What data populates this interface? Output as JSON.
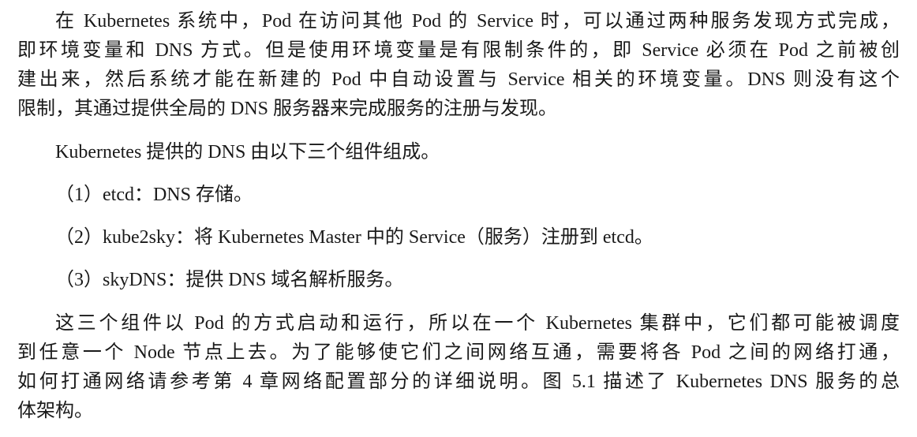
{
  "paragraph1": [
    "在 Kubernetes 系统中，Pod 在访问其他 Pod 的 Service 时，可以通过两种服务发现方式完成，",
    "即环境变量和 DNS 方式。但是使用环境变量是有限制条件的，即 Service 必须在 Pod 之前被创",
    "建出来，然后系统才能在新建的 Pod 中自动设置与 Service 相关的环境变量。DNS 则没有这个",
    "限制，其通过提供全局的 DNS 服务器来完成服务的注册与发现。"
  ],
  "paragraph2": "Kubernetes 提供的 DNS 由以下三个组件组成。",
  "list": [
    "（1）etcd：DNS 存储。",
    "（2）kube2sky：将 Kubernetes Master 中的 Service（服务）注册到 etcd。",
    "（3）skyDNS：提供 DNS 域名解析服务。"
  ],
  "paragraph3": [
    "这三个组件以 Pod 的方式启动和运行，所以在一个 Kubernetes 集群中，它们都可能被调度",
    "到任意一个 Node 节点上去。为了能够使它们之间网络互通，需要将各 Pod 之间的网络打通，",
    "如何打通网络请参考第 4 章网络配置部分的详细说明。图 5.1 描述了 Kubernetes DNS 服务的总",
    "体架构。"
  ]
}
